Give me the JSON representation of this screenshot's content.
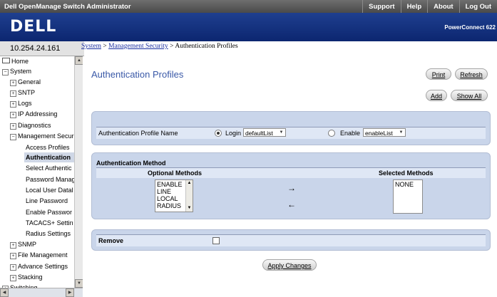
{
  "app_title": "Dell OpenManage Switch Administrator",
  "top_nav": [
    "Support",
    "Help",
    "About",
    "Log Out"
  ],
  "brand": {
    "logo": "DELL",
    "product": "PowerConnect 622"
  },
  "ip_address": "10.254.24.161",
  "breadcrumb": {
    "system": "System",
    "sep1": " > ",
    "mgmt": "Management Security",
    "sep2": " > ",
    "current": "Authentication Profiles"
  },
  "sidebar": {
    "items": [
      {
        "label": "Home",
        "icon": "monitor-icon"
      },
      {
        "label": "System",
        "icon": "expand-icon"
      },
      {
        "label": "General",
        "icon": "expand-icon"
      },
      {
        "label": "SNTP",
        "icon": "expand-icon"
      },
      {
        "label": "Logs",
        "icon": "expand-icon"
      },
      {
        "label": "IP Addressing",
        "icon": "expand-icon"
      },
      {
        "label": "Diagnostics",
        "icon": "expand-icon"
      },
      {
        "label": "Management Secur",
        "icon": "expand-icon"
      },
      {
        "label": "Access Profiles"
      },
      {
        "label": "Authentication"
      },
      {
        "label": "Select Authentic"
      },
      {
        "label": "Password Manag"
      },
      {
        "label": "Local User Datal"
      },
      {
        "label": "Line Password"
      },
      {
        "label": "Enable Passwor"
      },
      {
        "label": "TACACS+ Settin"
      },
      {
        "label": "Radius Settings"
      },
      {
        "label": "SNMP",
        "icon": "expand-icon"
      },
      {
        "label": "File Management",
        "icon": "expand-icon"
      },
      {
        "label": "Advance Settings",
        "icon": "expand-icon"
      },
      {
        "label": "Stacking",
        "icon": "expand-icon"
      },
      {
        "label": "Switching",
        "icon": "expand-icon"
      }
    ]
  },
  "main": {
    "title": "Authentication Profiles",
    "buttons": {
      "print": "Print",
      "refresh": "Refresh",
      "add": "Add",
      "show_all": "Show All",
      "apply": "Apply Changes"
    },
    "profile": {
      "label": "Authentication Profile Name",
      "login_label": "Login",
      "login_value": "defaultList",
      "enable_label": "Enable",
      "enable_value": "enableList"
    },
    "method": {
      "header": "Authentication Method",
      "optional_header": "Optional Methods",
      "selected_header": "Selected Methods",
      "optional_options": [
        "ENABLE",
        "LINE",
        "LOCAL",
        "RADIUS"
      ],
      "selected_options": [
        "NONE"
      ],
      "add_arrow": "→",
      "remove_arrow": "←"
    },
    "remove": {
      "label": "Remove"
    }
  }
}
